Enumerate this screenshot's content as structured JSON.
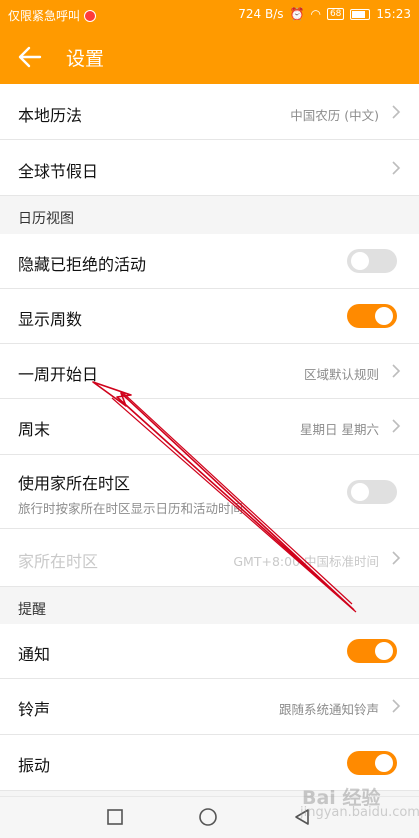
{
  "status_bar": {
    "carrier": "仅限紧急呼叫",
    "speed": "724 B/s",
    "badge": "68",
    "time": "15:23"
  },
  "app_bar": {
    "title": "设置",
    "back_icon": "arrow-left-icon"
  },
  "rows": {
    "local_calendar": {
      "label": "本地历法",
      "value": "中国农历 (中文)"
    },
    "holidays": {
      "label": "全球节假日"
    },
    "section_view": "日历视图",
    "hide_declined": {
      "label": "隐藏已拒绝的活动",
      "on": false
    },
    "show_week_numbers": {
      "label": "显示周数",
      "on": true
    },
    "week_start": {
      "label": "一周开始日",
      "value": "区域默认规则"
    },
    "weekend": {
      "label": "周末",
      "value": "星期日 星期六"
    },
    "home_timezone": {
      "label": "使用家所在时区",
      "sub": "旅行时按家所在时区显示日历和活动时间",
      "on": false
    },
    "home_tz_value": {
      "label": "家所在时区",
      "value": "GMT+8:00 中国标准时间"
    },
    "section_reminder": "提醒",
    "notify": {
      "label": "通知",
      "on": true
    },
    "ringtone": {
      "label": "铃声",
      "value": "跟随系统通知铃声"
    },
    "vibrate": {
      "label": "振动",
      "on": true
    }
  },
  "watermark": {
    "main": "Bai 经验",
    "sub": "jingyan.baidu.com"
  },
  "colors": {
    "accent": "#ff9a00",
    "toggle_on": "#ff8a00",
    "annotation_arrow": "#d0021b"
  }
}
